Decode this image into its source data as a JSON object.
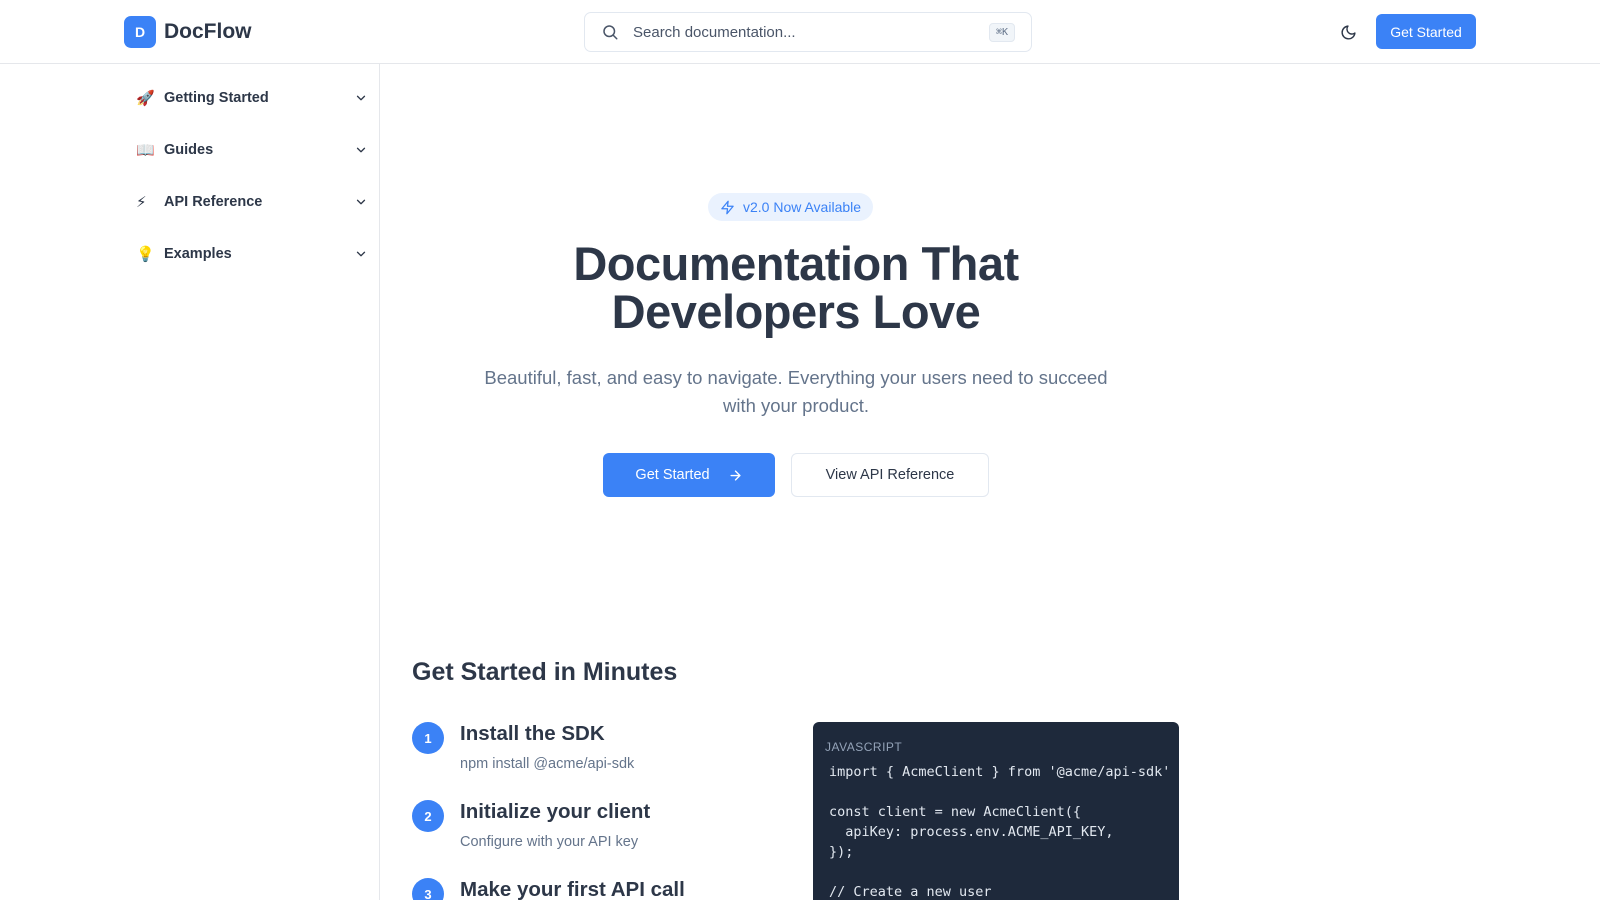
{
  "header": {
    "logo_letter": "D",
    "app_name": "DocFlow",
    "search_placeholder": "Search documentation...",
    "search_shortcut": "⌘K",
    "theme_icon": "moon-icon",
    "cta_label": "Get Started"
  },
  "sidebar": {
    "items": [
      {
        "emoji": "🚀",
        "label": "Getting Started",
        "icon": "rocket-icon"
      },
      {
        "emoji": "📖",
        "label": "Guides",
        "icon": "book-icon"
      },
      {
        "emoji": "⚡",
        "label": "API Reference",
        "icon": "lightning-icon"
      },
      {
        "emoji": "💡",
        "label": "Examples",
        "icon": "lightbulb-icon"
      }
    ]
  },
  "hero": {
    "badge": "v2.0 Now Available",
    "title_line1": "Documentation That",
    "title_line2": "Developers Love",
    "subtitle": "Beautiful, fast, and easy to navigate. Everything your users need to succeed with your product.",
    "primary_button": "Get Started",
    "secondary_button": "View API Reference"
  },
  "quickstart": {
    "title": "Get Started in Minutes",
    "steps": [
      {
        "number": "1",
        "title": "Install the SDK",
        "description": "npm install @acme/api-sdk"
      },
      {
        "number": "2",
        "title": "Initialize your client",
        "description": "Configure with your API key"
      },
      {
        "number": "3",
        "title": "Make your first API call",
        "description": ""
      }
    ],
    "code": {
      "language": "JAVASCRIPT",
      "content": "import { AcmeClient } from '@acme/api-sdk'\n\nconst client = new AcmeClient({\n  apiKey: process.env.ACME_API_KEY,\n});\n\n// Create a new user"
    }
  },
  "colors": {
    "accent": "#3b82f6",
    "text": "#2d3748",
    "muted": "#64748b",
    "code_bg": "#1e293b"
  }
}
